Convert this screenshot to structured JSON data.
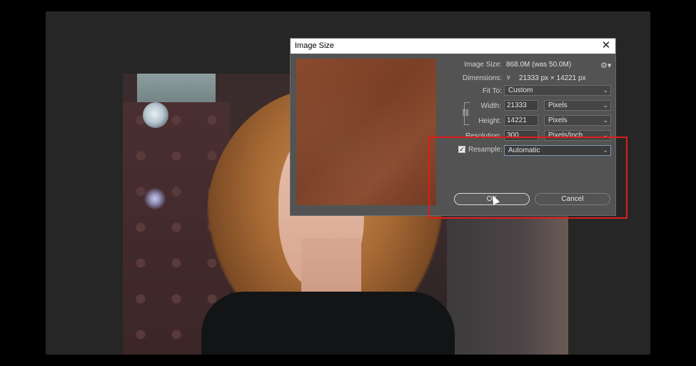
{
  "dialog": {
    "title": "Image Size",
    "close_glyph": "✕",
    "image_size_label": "Image Size:",
    "image_size_value": "868.0M (was 50.0M)",
    "dimensions_label": "Dimensions:",
    "dimensions_value": "21333 px  ×  14221 px",
    "fit_to_label": "Fit To:",
    "fit_to_value": "Custom",
    "width_label": "Width:",
    "width_value": "21333",
    "width_unit": "Pixels",
    "height_label": "Height:",
    "height_value": "14221",
    "height_unit": "Pixels",
    "resolution_label": "Resolution:",
    "resolution_value": "300",
    "resolution_unit": "Pixels/Inch",
    "resample_label": "Resample:",
    "resample_checked": true,
    "resample_value": "Automatic",
    "ok_label": "OK",
    "cancel_label": "Cancel"
  },
  "icons": {
    "gear": "gear-icon",
    "chain": "chain-link-icon",
    "close": "close-icon",
    "chevron": "chevron-down-icon"
  },
  "colors": {
    "highlight": "#e01b1b",
    "dialog_bg": "#535353",
    "workspace_bg": "#262626",
    "preview_bg": "#7a3f25"
  }
}
